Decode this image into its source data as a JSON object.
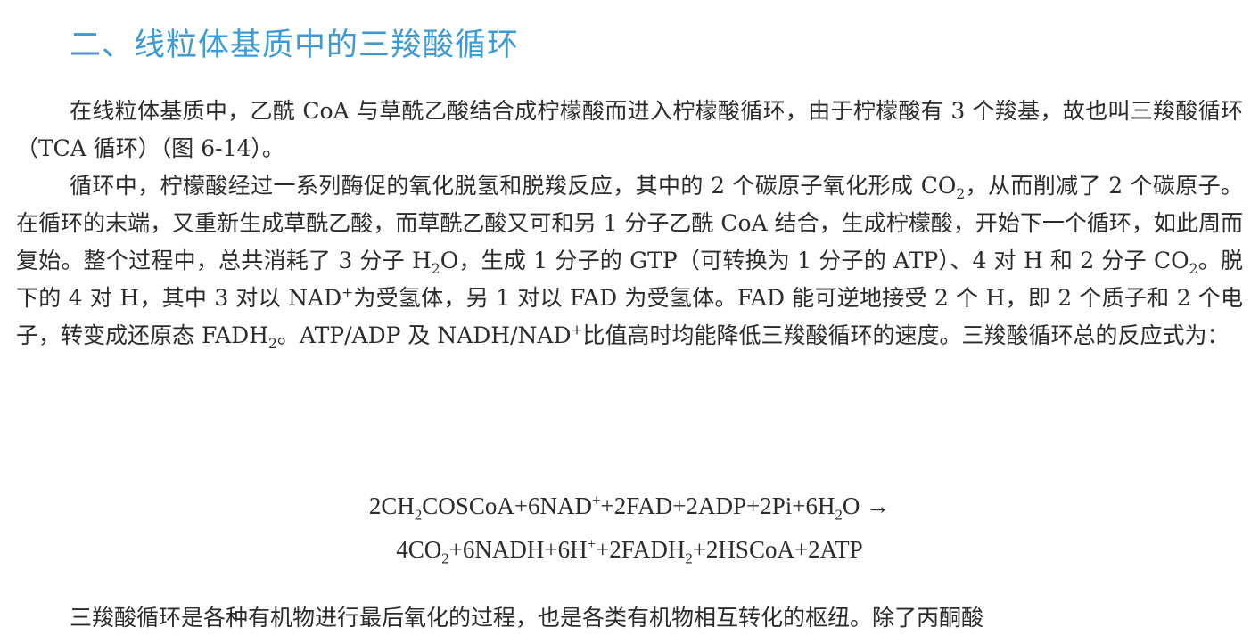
{
  "heading": "二、线粒体基质中的三羧酸循环",
  "paragraphs": [
    "在线粒体基质中，乙酰 CoA 与草酰乙酸结合成柠檬酸而进入柠檬酸循环，由于柠檬酸有 3 个羧基，故也叫三羧酸循环（TCA 循环）（图 6-14）。",
    "循环中，柠檬酸经过一系列酶促的氧化脱氢和脱羧反应，其中的 2 个碳原子氧化形成 CO<sub>2</sub>，从而削减了 2 个碳原子。在循环的末端，又重新生成草酰乙酸，而草酰乙酸又可和另 1 分子乙酰 CoA 结合，生成柠檬酸，开始下一个循环，如此周而复始。整个过程中，总共消耗了 3 分子 H<sub>2</sub>O，生成 1 分子的 GTP（可转换为 1 分子的 ATP）、4 对 H 和 2 分子 CO<sub>2</sub>。脱下的 4 对 H，其中 3 对以 NAD<sup>+</sup>为受氢体，另 1 对以 FAD 为受氢体。FAD 能可逆地接受 2 个 H，即 2 个质子和 2 个电子，转变成还原态 FADH<sub>2</sub>。ATP/ADP 及 NADH/NAD<sup>+</sup>比值高时均能降低三羧酸循环的速度。三羧酸循环总的反应式为："
  ],
  "equation": {
    "line1": "2CH<sub>2</sub>COSCoA+6NAD<sup>+</sup>+2FAD+2ADP+2Pi+6H<sub>2</sub>O →",
    "line2": "4CO<sub>2</sub>+6NADH+6H<sup>+</sup>+2FADH<sub>2</sub>+2HSCoA+2ATP"
  },
  "last_paragraph": "三羧酸循环是各种有机物进行最后氧化的过程，也是各类有机物相互转化的枢纽。除了丙酮酸"
}
